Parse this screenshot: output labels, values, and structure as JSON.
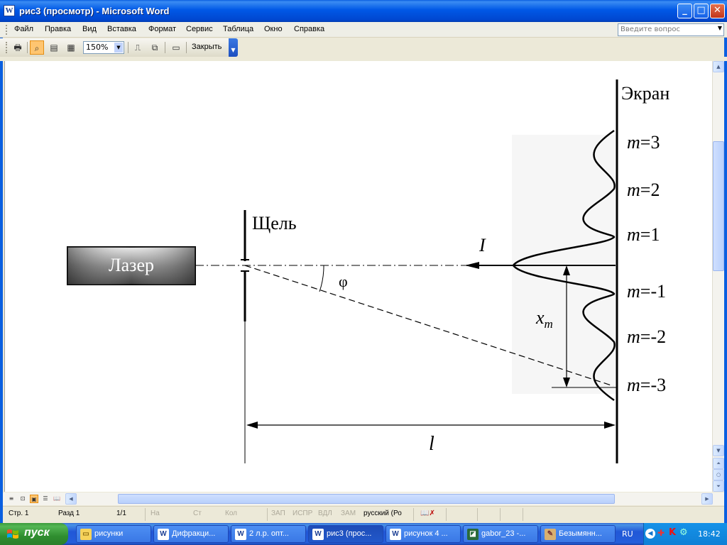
{
  "window": {
    "title": "рис3 (просмотр) - Microsoft Word",
    "icon_letter": "W"
  },
  "menu": {
    "items": [
      "Файл",
      "Правка",
      "Вид",
      "Вставка",
      "Формат",
      "Сервис",
      "Таблица",
      "Окно",
      "Справка"
    ],
    "help_placeholder": "Введите вопрос"
  },
  "toolbar": {
    "zoom": "150%",
    "close_label": "Закрыть"
  },
  "figure": {
    "laser_label": "Лазер",
    "slit_label": "Щель",
    "screen_label": "Экран",
    "angle_label": "φ",
    "intensity_label": "I",
    "xm_label": "x",
    "xm_sub": "m",
    "distance_label": "l",
    "orders": [
      {
        "m": "m",
        "value": "=3"
      },
      {
        "m": "m",
        "value": "=2"
      },
      {
        "m": "m",
        "value": "=1"
      },
      {
        "m": "m",
        "value": "=-1"
      },
      {
        "m": "m",
        "value": "=-2"
      },
      {
        "m": "m",
        "value": "=-3"
      }
    ]
  },
  "status": {
    "page": "Стр.  1",
    "section": "Разд  1",
    "pages": "1/1",
    "at": "На",
    "line": "Ст",
    "col": "Кол",
    "rec": "ЗАП",
    "trk": "ИСПР",
    "ext": "ВДЛ",
    "ovr": "ЗАМ",
    "language": "русский (Ро"
  },
  "taskbar": {
    "start_label": "пуск",
    "tasks": [
      "рисунки",
      "Дифракци...",
      "2 л.р. опт...",
      "рис3 (прос...",
      "рисунок 4 ...",
      "gabor_23 -...",
      "Безымянн..."
    ],
    "lang": "RU",
    "clock": "18:42"
  }
}
